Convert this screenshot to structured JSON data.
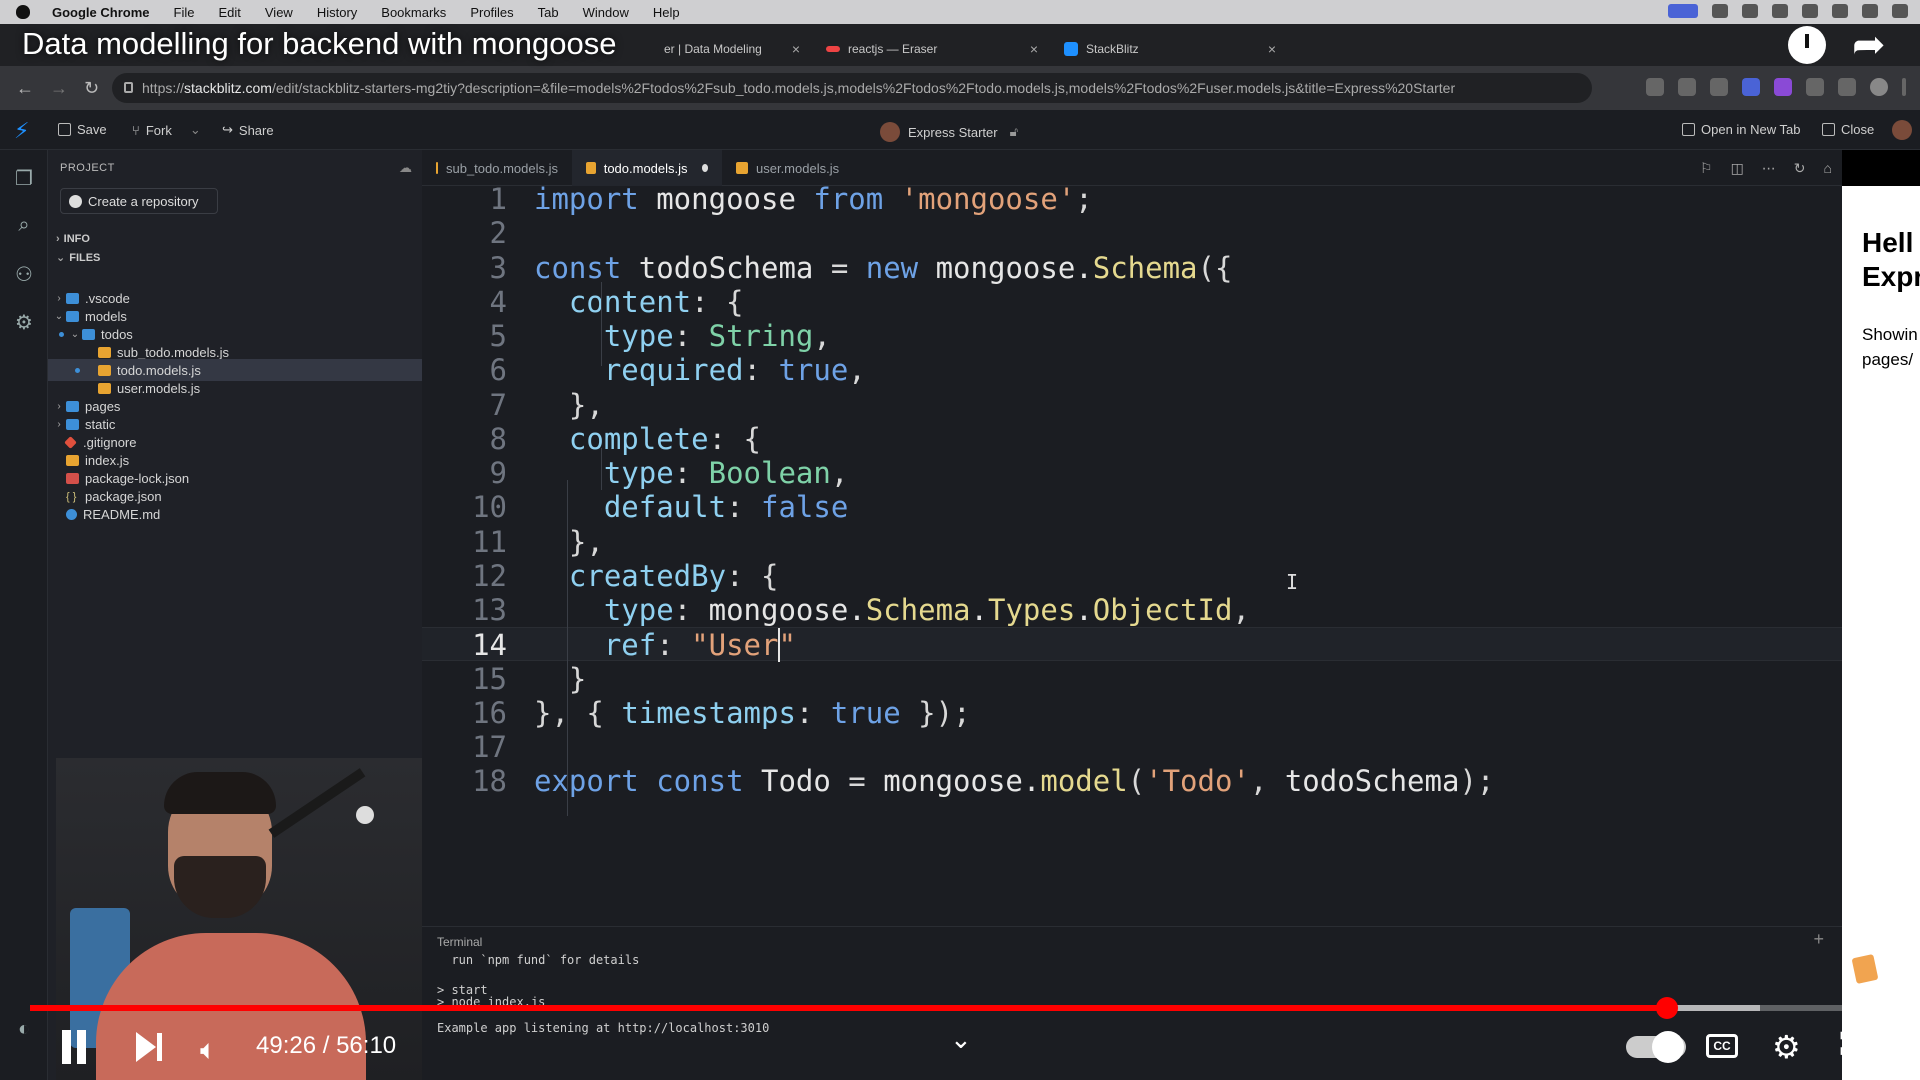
{
  "menubar": {
    "app": "Google Chrome",
    "items": [
      "File",
      "Edit",
      "View",
      "History",
      "Bookmarks",
      "Profiles",
      "Tab",
      "Window",
      "Help"
    ]
  },
  "browser": {
    "tabs": [
      {
        "title": "er | Data Modeling",
        "color": "#6c8ebf"
      },
      {
        "title": "reactjs — Eraser",
        "color": "#e44"
      },
      {
        "title": "StackBlitz",
        "color": "#1e90ff"
      }
    ],
    "url_prefix": "https://",
    "url_host": "stackblitz.com",
    "url_path": "/edit/stackblitz-starters-mg2tiy?description=&file=models%2Ftodos%2Fsub_todo.models.js,models%2Ftodos%2Ftodo.models.js,models%2Ftodos%2Fuser.models.js&title=Express%20Starter"
  },
  "stackblitz": {
    "save": "Save",
    "fork": "Fork",
    "share": "Share",
    "project_title": "Express Starter",
    "open_new_tab": "Open in New Tab",
    "close": "Close"
  },
  "explorer": {
    "project_label": "PROJECT",
    "create_repo": "Create a repository",
    "info_label": "INFO",
    "files_label": "FILES",
    "tree": [
      {
        "name": ".vscode",
        "kind": "folder",
        "depth": 1,
        "chev": "›"
      },
      {
        "name": "models",
        "kind": "folder",
        "depth": 1,
        "chev": "⌄",
        "dot": true
      },
      {
        "name": "todos",
        "kind": "folder",
        "depth": 2,
        "chev": "⌄",
        "dot": true
      },
      {
        "name": "sub_todo.models.js",
        "kind": "js",
        "depth": 3
      },
      {
        "name": "todo.models.js",
        "kind": "js",
        "depth": 3,
        "selected": true,
        "dot": true
      },
      {
        "name": "user.models.js",
        "kind": "js",
        "depth": 3
      },
      {
        "name": "pages",
        "kind": "folder",
        "depth": 1,
        "chev": "›"
      },
      {
        "name": "static",
        "kind": "folder",
        "depth": 1,
        "chev": "›"
      },
      {
        "name": ".gitignore",
        "kind": "git",
        "depth": 1
      },
      {
        "name": "index.js",
        "kind": "js",
        "depth": 1
      },
      {
        "name": "package-lock.json",
        "kind": "json",
        "depth": 1
      },
      {
        "name": "package.json",
        "kind": "pj",
        "depth": 1
      },
      {
        "name": "README.md",
        "kind": "info",
        "depth": 1
      }
    ]
  },
  "editor_tabs": [
    {
      "label": "sub_todo.models.js",
      "active": false
    },
    {
      "label": "todo.models.js",
      "active": true,
      "modified": true
    },
    {
      "label": "user.models.js",
      "active": false
    }
  ],
  "code_lines": [
    {
      "n": "1",
      "t": [
        [
          "k",
          "import"
        ],
        [
          "id",
          " mongoose "
        ],
        [
          "k",
          "from"
        ],
        [
          "st",
          " 'mongoose'"
        ],
        [
          "pu",
          ";"
        ]
      ]
    },
    {
      "n": "2",
      "t": []
    },
    {
      "n": "3",
      "t": [
        [
          "k",
          "const"
        ],
        [
          "id",
          " todoSchema "
        ],
        [
          "pu",
          "= "
        ],
        [
          "k",
          "new"
        ],
        [
          "id",
          " mongoose."
        ],
        [
          "fn",
          "Schema"
        ],
        [
          "pu",
          "({"
        ]
      ]
    },
    {
      "n": "4",
      "t": [
        [
          "pu",
          "  "
        ],
        [
          "pr",
          "content"
        ],
        [
          "pu",
          ": {"
        ]
      ]
    },
    {
      "n": "5",
      "t": [
        [
          "pu",
          "    "
        ],
        [
          "pr",
          "type"
        ],
        [
          "pu",
          ": "
        ],
        [
          "ty",
          "String"
        ],
        [
          "pu",
          ","
        ]
      ]
    },
    {
      "n": "6",
      "t": [
        [
          "pu",
          "    "
        ],
        [
          "pr",
          "required"
        ],
        [
          "pu",
          ": "
        ],
        [
          "bl",
          "true"
        ],
        [
          "pu",
          ","
        ]
      ]
    },
    {
      "n": "7",
      "t": [
        [
          "pu",
          "  },"
        ]
      ]
    },
    {
      "n": "8",
      "t": [
        [
          "pu",
          "  "
        ],
        [
          "pr",
          "complete"
        ],
        [
          "pu",
          ": {"
        ]
      ]
    },
    {
      "n": "9",
      "t": [
        [
          "pu",
          "    "
        ],
        [
          "pr",
          "type"
        ],
        [
          "pu",
          ": "
        ],
        [
          "ty",
          "Boolean"
        ],
        [
          "pu",
          ","
        ]
      ]
    },
    {
      "n": "10",
      "t": [
        [
          "pu",
          "    "
        ],
        [
          "pr",
          "default"
        ],
        [
          "pu",
          ": "
        ],
        [
          "bl",
          "false"
        ]
      ]
    },
    {
      "n": "11",
      "t": [
        [
          "pu",
          "  },"
        ]
      ]
    },
    {
      "n": "12",
      "t": [
        [
          "pu",
          "  "
        ],
        [
          "pr",
          "createdBy"
        ],
        [
          "pu",
          ": {"
        ]
      ]
    },
    {
      "n": "13",
      "t": [
        [
          "pu",
          "    "
        ],
        [
          "pr",
          "type"
        ],
        [
          "pu",
          ": "
        ],
        [
          "id",
          "mongoose."
        ],
        [
          "fn",
          "Schema"
        ],
        [
          "id",
          "."
        ],
        [
          "fn",
          "Types"
        ],
        [
          "id",
          "."
        ],
        [
          "fn",
          "ObjectId"
        ],
        [
          "pu",
          ","
        ]
      ]
    },
    {
      "n": "14",
      "t": [
        [
          "pu",
          "    "
        ],
        [
          "pr",
          "ref"
        ],
        [
          "pu",
          ": "
        ],
        [
          "st",
          "\"User\""
        ]
      ],
      "current": true
    },
    {
      "n": "15",
      "t": [
        [
          "pu",
          "  }"
        ]
      ]
    },
    {
      "n": "16",
      "t": [
        [
          "pu",
          "}, { "
        ],
        [
          "pr",
          "timestamps"
        ],
        [
          "pu",
          ": "
        ],
        [
          "bl",
          "true"
        ],
        [
          "pu",
          " });"
        ]
      ]
    },
    {
      "n": "17",
      "t": []
    },
    {
      "n": "18",
      "t": [
        [
          "k",
          "export"
        ],
        [
          "k",
          " const"
        ],
        [
          "id",
          " Todo "
        ],
        [
          "pu",
          "= "
        ],
        [
          "id",
          "mongoose."
        ],
        [
          "fn",
          "model"
        ],
        [
          "pu",
          "("
        ],
        [
          "st",
          "'Todo'"
        ],
        [
          "pu",
          ", "
        ],
        [
          "id",
          "todoSchema"
        ],
        [
          "pu",
          ");"
        ]
      ]
    }
  ],
  "terminal": {
    "title": "Terminal",
    "lines": [
      "  run `npm fund` for details",
      "",
      "> start",
      "> node index.js",
      "",
      "Example app listening at http://localhost:3010"
    ]
  },
  "preview": {
    "heading_1": "Hell",
    "heading_2": "Expr",
    "text_1": "Showin",
    "text_2": "pages/"
  },
  "youtube": {
    "video_title": "Data modelling for backend with mongoose",
    "current_time": "49:26",
    "duration": "56:10",
    "progress_fraction": 0.88,
    "buffer_fraction": 0.93,
    "cc_label": "CC"
  },
  "colors": {
    "accent": "#1e90ff",
    "progress": "#ff0000",
    "editor_bg": "#1b1d22"
  }
}
